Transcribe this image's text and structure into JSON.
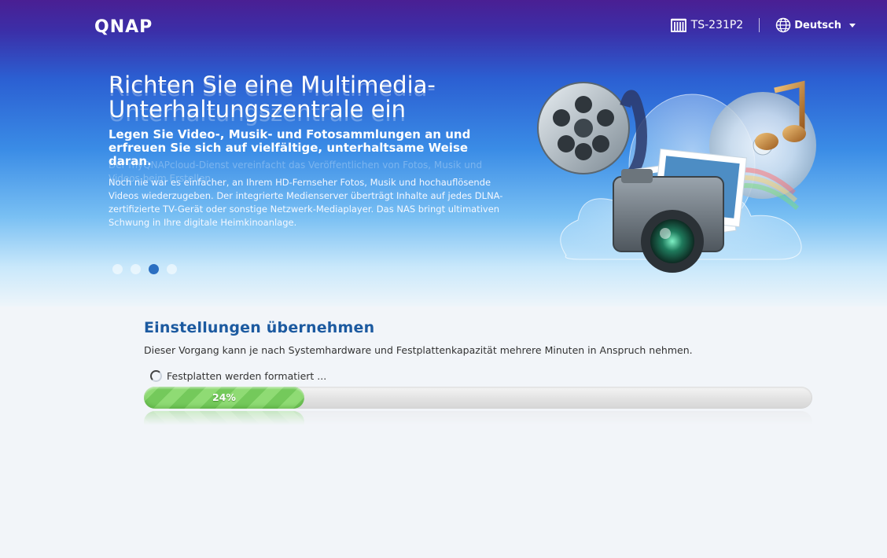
{
  "header": {
    "logo": "QNAP",
    "model": "TS-231P2",
    "language": "Deutsch",
    "icons": {
      "model": "nas-device-icon",
      "language": "globe-icon",
      "dropdown": "chevron-down-icon"
    }
  },
  "carousel": {
    "ghost_title": "Richten Sie eine Multimedia-Unterhaltungszentrale ein",
    "ghost_text": "Der myQNAPcloud-Dienst vereinfacht das Veröffentlichen von Fotos, Musik und Videos beim Erstellen",
    "title": "Richten Sie eine Multimedia-Unterhaltungszentrale ein",
    "subtitle": "Legen Sie Video-, Musik- und Fotosammlungen an und erfreuen Sie sich auf vielfältige, unterhaltsame Weise daran.",
    "description": "Noch nie war es einfacher, an Ihrem HD-Fernseher Fotos, Musik und hochauflösende Videos wiederzugeben. Der integrierte Medienserver überträgt Inhalte auf jedes DLNA-zertifizierte TV-Gerät oder sonstige Netzwerk-Mediaplayer. Das NAS bringt ultimativen Schwung in Ihre digitale Heimkinoanlage.",
    "slide_count": 4,
    "active_slide": 3,
    "illustration_icon": "multimedia-illustration-icon"
  },
  "panel": {
    "title": "Einstellungen übernehmen",
    "description": "Dieser Vorgang kann je nach Systemhardware und Festplattenkapazität mehrere Minuten in Anspruch nehmen.",
    "status": "Festplatten werden formatiert ...",
    "progress_percent": 24,
    "progress_label": "24%"
  },
  "colors": {
    "accent_title": "#1c5aa0",
    "progress_green": "#8fdb74",
    "dot_active": "#2b6fc2"
  }
}
